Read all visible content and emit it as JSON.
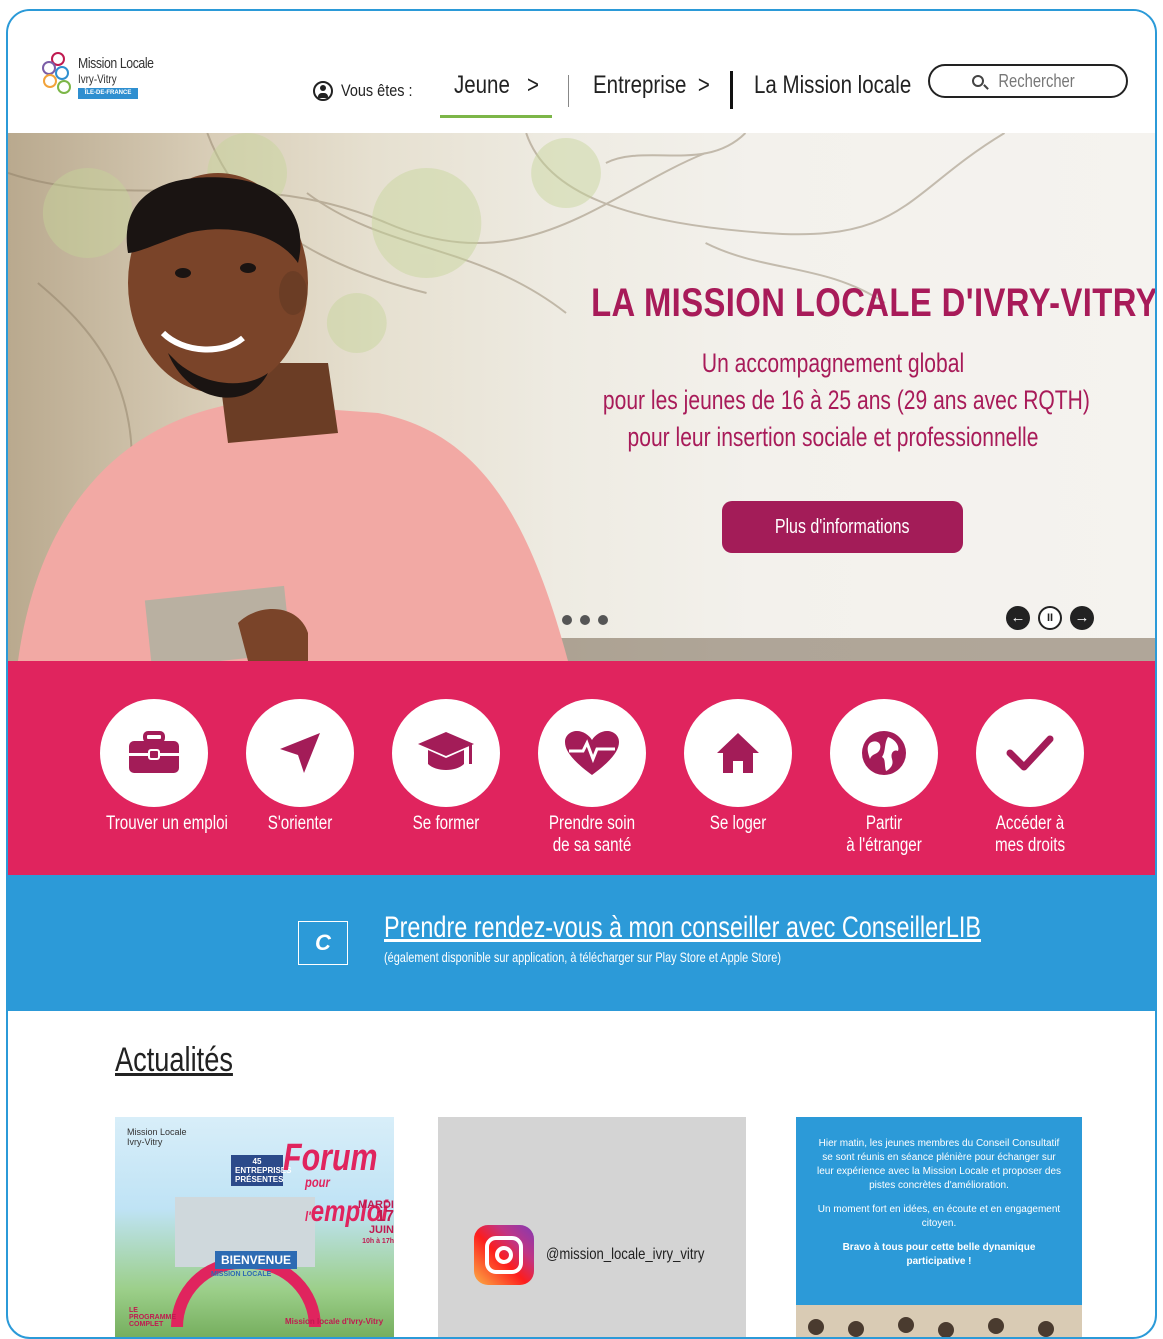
{
  "header": {
    "logo": {
      "line1": "Mission Locale",
      "line2": "Ivry-Vitry",
      "badge": "ÎLE-DE-FRANCE"
    },
    "vous_etes": "Vous êtes :",
    "nav": [
      {
        "label": "Jeune",
        "arrow": ">"
      },
      {
        "label": "Entreprise",
        "arrow": ">"
      },
      {
        "label": "La Mission locale"
      }
    ],
    "search_placeholder": "Rechercher",
    "colors": {
      "active_underline": "#7cb648"
    }
  },
  "hero": {
    "title": "LA MISSION LOCALE D'IVRY-VITRY",
    "subtitle": [
      "Un accompagnement global",
      "pour les jeunes de 16 à 25 ans (29 ans avec RQTH)",
      "pour leur insertion sociale et professionnelle"
    ],
    "button": "Plus d'informations",
    "slide_count": 3,
    "controls": {
      "prev": "←",
      "pause": "II",
      "next": "→"
    },
    "colors": {
      "accent": "#a81b59"
    }
  },
  "tiles": [
    {
      "label": "Trouver un emploi",
      "icon": "briefcase-icon"
    },
    {
      "label": "S'orienter",
      "icon": "navigation-arrow-icon"
    },
    {
      "label": "Se former",
      "icon": "graduation-cap-icon"
    },
    {
      "label": "Prendre soin\nde sa santé",
      "icon": "heart-pulse-icon"
    },
    {
      "label": "Se loger",
      "icon": "home-icon"
    },
    {
      "label": "Partir\nà l'étranger",
      "icon": "globe-icon"
    },
    {
      "label": "Accéder à\nmes droits",
      "icon": "check-icon"
    }
  ],
  "conseillerlib": {
    "icon_letter": "C",
    "link": "Prendre rendez-vous à mon conseiller avec ConseillerLIB",
    "note": "(également disponible sur application, à télécharger sur Play Store et Apple Store)"
  },
  "news": {
    "title": "Actualités",
    "forum": {
      "logo_line1": "Mission Locale",
      "logo_line2": "Ivry-Vitry",
      "badge": "45 ENTREPRISES PRÉSENTES",
      "word1": "Forum",
      "word_pour": "pour l'",
      "word2": "emploi",
      "day": "MARDI",
      "date": "17",
      "month": "JUIN",
      "time": "10h à 17h",
      "banner": "BIENVENUE",
      "arch_text": "MISSION LOCALE",
      "programme": "LE PROGRAMME COMPLET",
      "ml": "Mission locale d'Ivry-Vitry"
    },
    "instagram_handle": "@mission_locale_ivry_vitry",
    "post": {
      "p1": "Hier matin, les jeunes membres du Conseil Consultatif se sont réunis en séance plénière pour échanger sur leur expérience avec la Mission Locale et proposer des pistes concrètes d'amélioration.",
      "p2": "Un moment fort en idées, en écoute et en engagement citoyen.",
      "p3": "Bravo à tous pour cette belle dynamique participative !"
    }
  },
  "colors": {
    "pink": "#e0245e",
    "blue": "#2c9ad8",
    "magenta": "#a31c58"
  }
}
